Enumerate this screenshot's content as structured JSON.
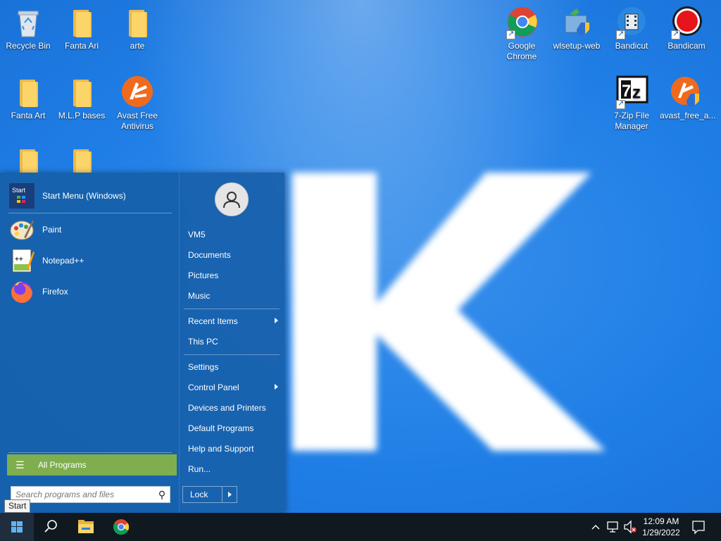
{
  "desktop": {
    "icons": [
      {
        "label": "Recycle Bin"
      },
      {
        "label": "Fanta Ari"
      },
      {
        "label": "arte"
      },
      {
        "label": "Google Chrome"
      },
      {
        "label": "wlsetup-web"
      },
      {
        "label": "Bandicut"
      },
      {
        "label": "Bandicam"
      },
      {
        "label": "Fanta Art"
      },
      {
        "label": "M.L.P bases"
      },
      {
        "label": "Avast Free Antivirus"
      },
      {
        "label": "7-Zip File Manager"
      },
      {
        "label": "avast_free_a..."
      }
    ]
  },
  "start_menu": {
    "pinned": [
      {
        "label": "Start Menu (Windows)",
        "icon_text": "Start"
      },
      {
        "label": "Paint"
      },
      {
        "label": "Notepad++"
      },
      {
        "label": "Firefox"
      }
    ],
    "all_programs_label": "All Programs",
    "search_placeholder": "Search programs and files",
    "right": {
      "user": "VM5",
      "items_group1": [
        "Documents",
        "Pictures",
        "Music"
      ],
      "items_group2": [
        {
          "label": "Recent Items",
          "submenu": true
        },
        {
          "label": "This PC",
          "submenu": false
        }
      ],
      "items_group3": [
        {
          "label": "Settings",
          "submenu": false
        },
        {
          "label": "Control Panel",
          "submenu": true
        },
        {
          "label": "Devices and Printers",
          "submenu": false
        },
        {
          "label": "Default Programs",
          "submenu": false
        },
        {
          "label": "Help and Support",
          "submenu": false
        },
        {
          "label": "Run...",
          "submenu": false
        }
      ],
      "lock_label": "Lock"
    }
  },
  "tooltip": "Start",
  "taskbar": {
    "clock_time": "12:09 AM",
    "clock_date": "1/29/2022"
  },
  "colors": {
    "wallpaper": "#2f86e6",
    "start_menu_bg": "#1660aa",
    "all_programs_bg": "#7fae4f",
    "taskbar_bg": "#101820"
  }
}
